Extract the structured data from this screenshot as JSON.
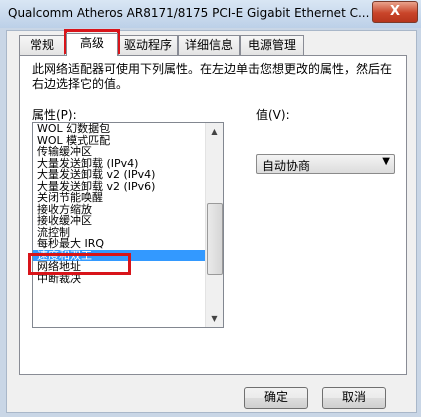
{
  "window": {
    "title": "Qualcomm Atheros AR8171/8175 PCI-E Gigabit Ethernet C...",
    "close_label": "X"
  },
  "tabs": [
    "常规",
    "高级",
    "驱动程序",
    "详细信息",
    "电源管理"
  ],
  "panel": {
    "description": "此网络适配器可使用下列属性。在左边单击您想更改的属性，然后在右边选择它的值。",
    "property_label": "属性(P):",
    "value_label": "值(V):",
    "properties": [
      "WOL 幻数据包",
      "WOL 模式匹配",
      "传输缓冲区",
      "大量发送卸载 (IPv4)",
      "大量发送卸载 v2 (IPv4)",
      "大量发送卸载 v2 (IPv6)",
      "关闭节能唤醒",
      "接收方缩放",
      "接收缓冲区",
      "流控制",
      "每秒最大 IRQ",
      "速度和双工",
      "网络地址",
      "中断裁决"
    ],
    "selected_property": "速度和双工",
    "value_selected": "自动协商"
  },
  "buttons": {
    "ok": "确定",
    "cancel": "取消"
  },
  "colors": {
    "highlight_box": "#d8141a",
    "selection": "#3399ff"
  }
}
